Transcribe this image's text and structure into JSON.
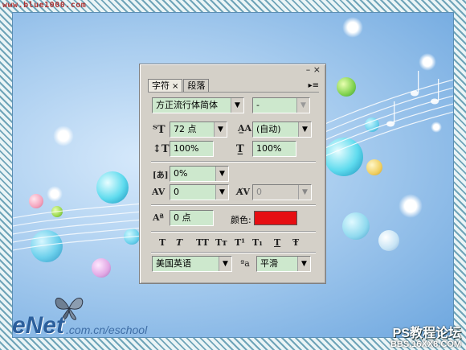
{
  "watermark_top": "www.blue1000.com",
  "footer": {
    "brand": "eNet",
    "brand_url": ".com.cn/eschool",
    "forum": "PS教程论坛",
    "forum_url": "BBS.16XX8.COM"
  },
  "panel": {
    "tabs": [
      {
        "label": "字符",
        "close": "×"
      },
      {
        "label": "段落"
      }
    ],
    "window_controls": "– ×",
    "font_family": "方正流行体简体",
    "font_style": "-",
    "font_size": "72 点",
    "leading": "(自动)",
    "vertical_scale": "100%",
    "horizontal_scale": "100%",
    "tsume": "0%",
    "kerning": "0",
    "tracking": "0",
    "baseline_shift": "0 点",
    "color_label": "颜色:",
    "color_value": "#e60e12",
    "format_buttons": [
      "T",
      "T",
      "TT",
      "Tт",
      "T¹",
      "T₁",
      "T",
      "Ŧ"
    ],
    "language": "美国英语",
    "aa_label": "ªa",
    "antialias": "平滑"
  }
}
